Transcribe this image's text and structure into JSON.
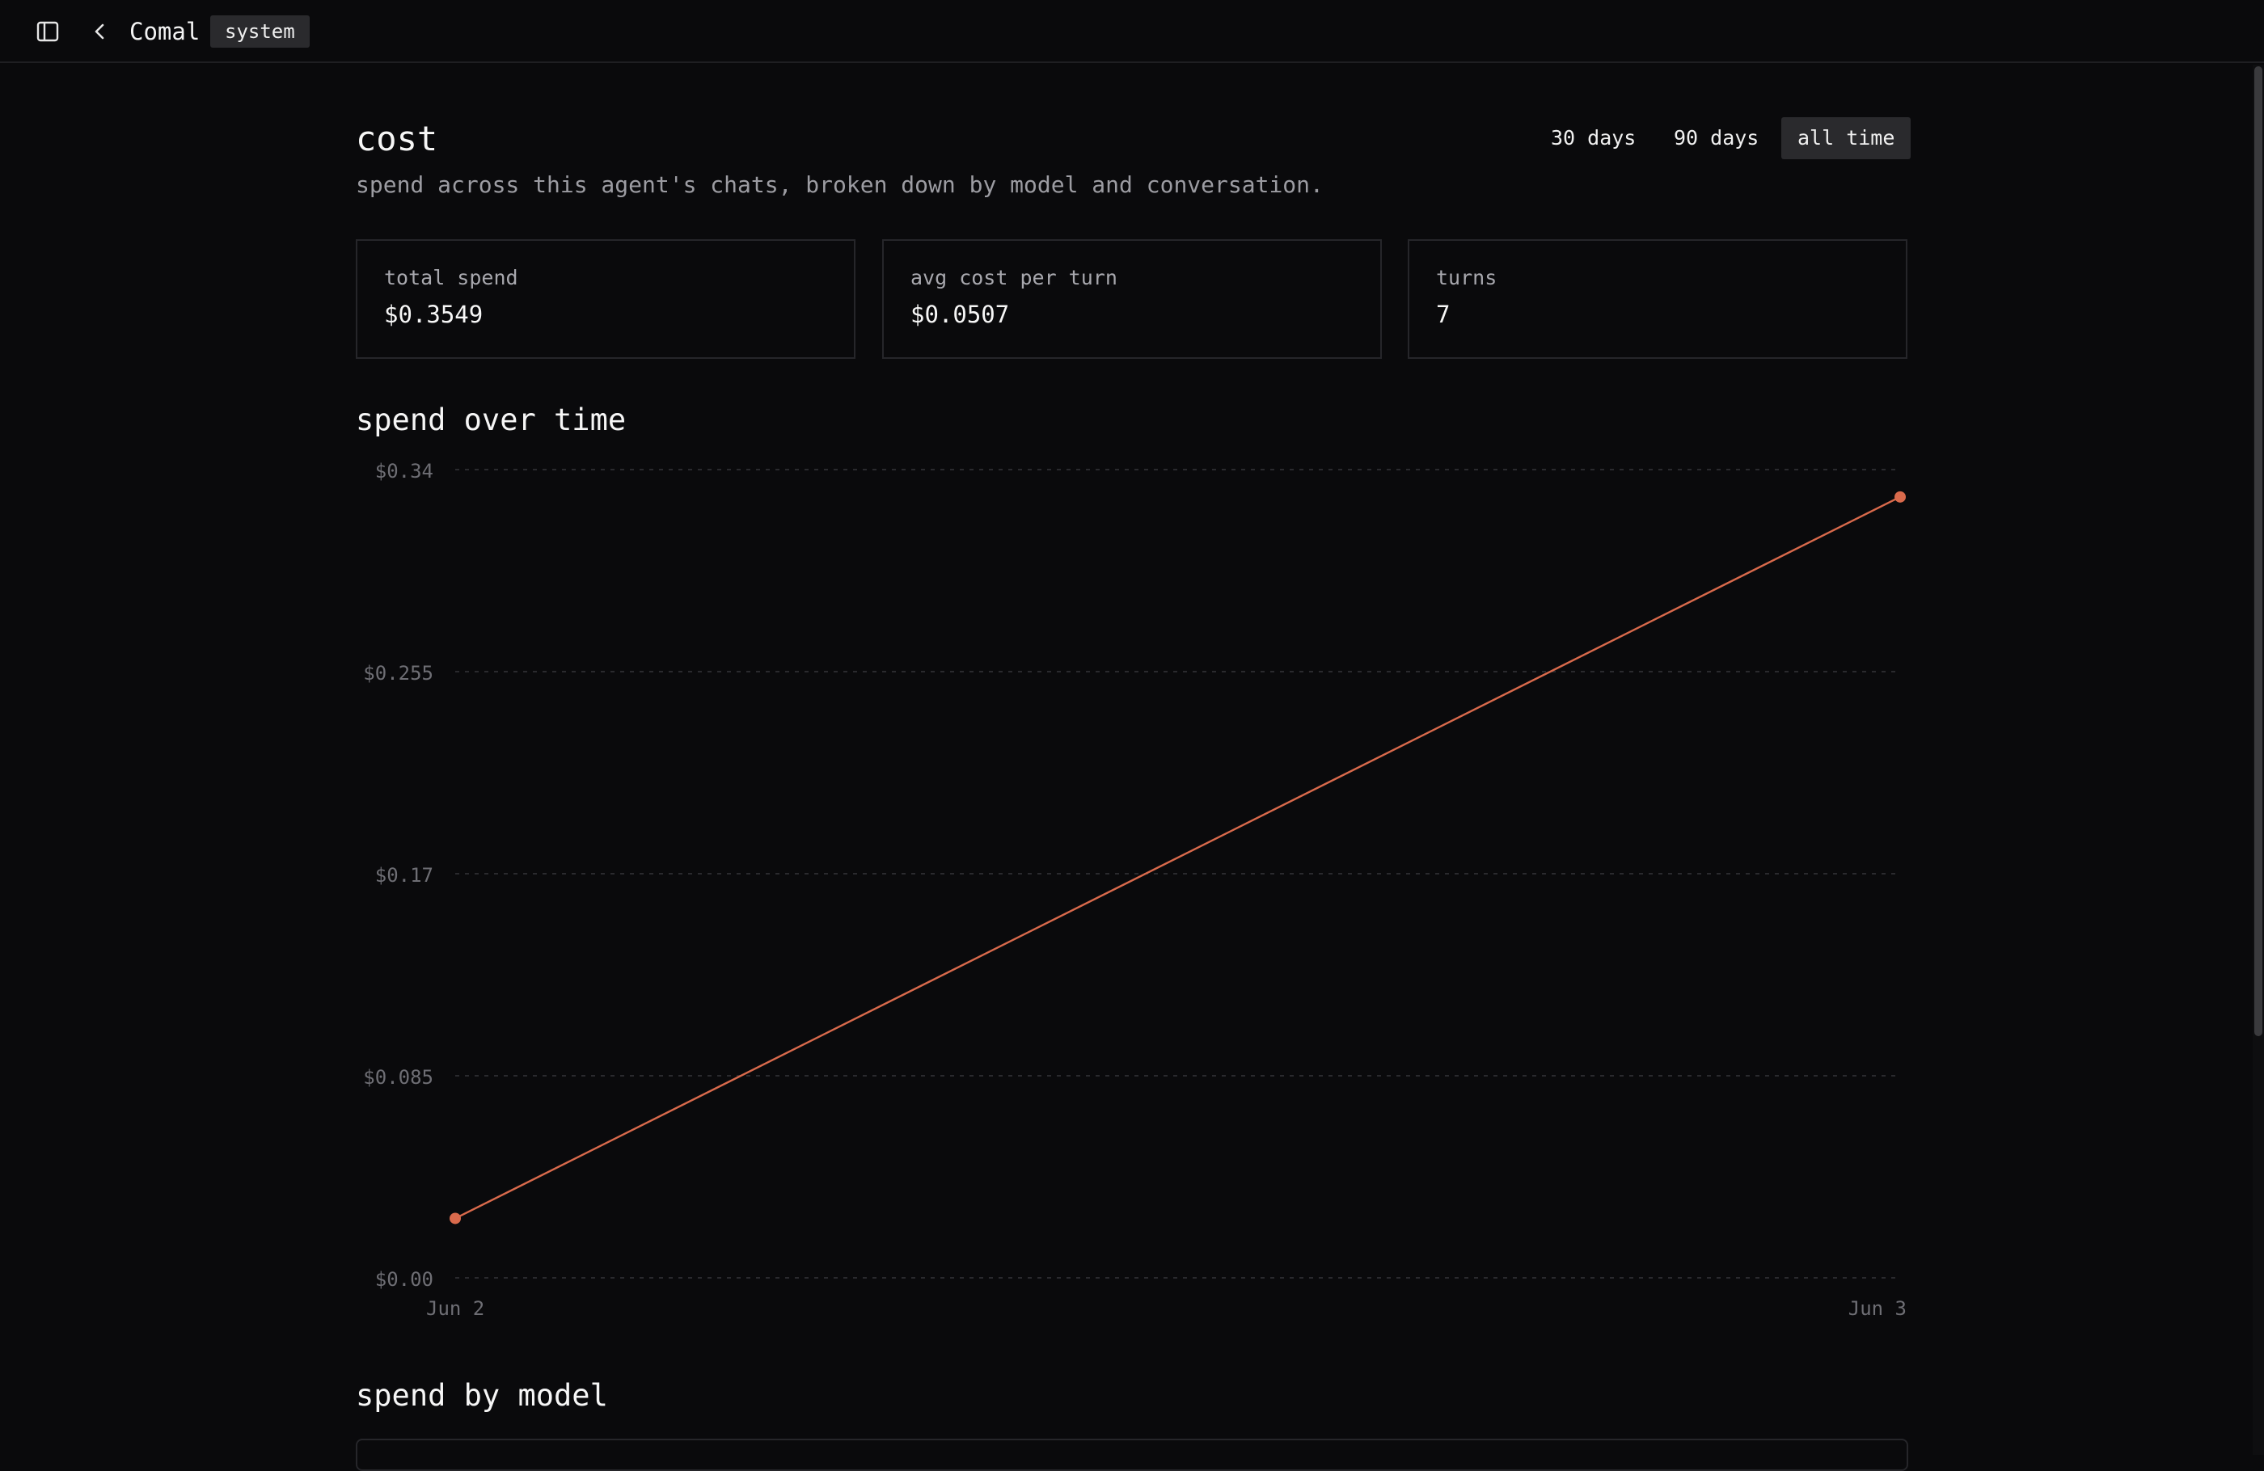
{
  "header": {
    "agent_name": "Comal",
    "agent_tag": "system",
    "sidebar_icon": "sidebar-toggle-icon",
    "back_icon": "chevron-left-icon"
  },
  "page": {
    "title": "cost",
    "subtitle": "spend across this agent's chats, broken down by model and conversation."
  },
  "range": {
    "options": [
      "30 days",
      "90 days",
      "all time"
    ],
    "selected": "all time"
  },
  "stats": [
    {
      "label": "total spend",
      "value": "$0.3549"
    },
    {
      "label": "avg cost per turn",
      "value": "$0.0507"
    },
    {
      "label": "turns",
      "value": "7"
    }
  ],
  "sections": {
    "spend_over_time": "spend over time",
    "spend_by_model": "spend by model"
  },
  "colors": {
    "background": "#0a0a0c",
    "accent": "#d96a4c",
    "muted_text": "#9c9ca2",
    "border": "#26262a"
  },
  "chart_data": {
    "type": "line",
    "x": [
      "Jun 2",
      "Jun 3"
    ],
    "series": [
      {
        "values": [
          0.025,
          0.3285
        ]
      }
    ],
    "yticks": [
      "$0.00",
      "$0.085",
      "$0.17",
      "$0.255",
      "$0.34"
    ],
    "ytick_values": [
      0,
      0.085,
      0.17,
      0.255,
      0.34
    ],
    "ylim": [
      0,
      0.34
    ],
    "grid": true,
    "legend": "none"
  }
}
